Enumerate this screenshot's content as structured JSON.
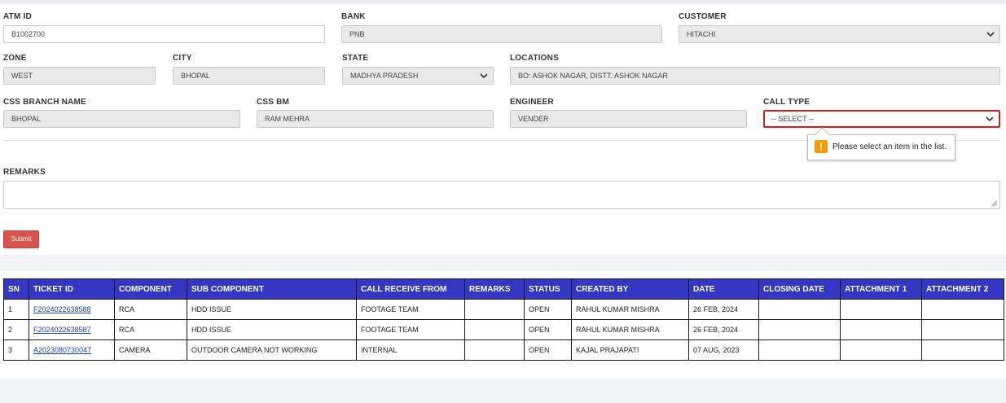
{
  "form": {
    "atm_id": {
      "label": "ATM ID",
      "value": "B1002700"
    },
    "bank": {
      "label": "BANK",
      "value": "PNB"
    },
    "customer": {
      "label": "CUSTOMER",
      "value": "HITACHI"
    },
    "zone": {
      "label": "ZONE",
      "value": "WEST"
    },
    "city": {
      "label": "CITY",
      "value": "BHOPAL"
    },
    "state": {
      "label": "STATE",
      "value": "MADHYA PRADESH"
    },
    "locations": {
      "label": "LOCATIONS",
      "value": "BO: ASHOK NAGAR, DISTT. ASHOK NAGAR"
    },
    "css_branch_name": {
      "label": "CSS BRANCH NAME",
      "value": "BHOPAL"
    },
    "css_bm": {
      "label": "CSS BM",
      "value": "RAM MEHRA"
    },
    "engineer": {
      "label": "ENGINEER",
      "value": "VENDER"
    },
    "call_type": {
      "label": "CALL TYPE",
      "value": "-- SELECT --"
    },
    "remarks": {
      "label": "REMARKS",
      "value": ""
    },
    "submit_label": "Submit"
  },
  "validation": {
    "message": "Please select an item in the list.",
    "icon": "warning-icon",
    "color": "#f39c12"
  },
  "colors": {
    "table_header": "#3437c4",
    "submit": "#d9534f",
    "invalid_border": "#d81b1b",
    "link": "#1a3ed6"
  },
  "table": {
    "headers": [
      "SN",
      "TICKET ID",
      "COMPONENT",
      "SUB COMPONENT",
      "CALL RECEIVE FROM",
      "REMARKS",
      "STATUS",
      "CREATED BY",
      "DATE",
      "CLOSING DATE",
      "ATTACHMENT 1",
      "ATTACHMENT 2"
    ],
    "rows": [
      {
        "sn": "1",
        "ticket_id": "F2024022638588",
        "component": "RCA",
        "sub_component": "HDD ISSUE",
        "call_receive_from": "FOOTAGE TEAM",
        "remarks": "",
        "status": "OPEN",
        "created_by": "RAHUL KUMAR MISHRA",
        "date": "26 FEB, 2024",
        "closing_date": "",
        "attachment_1": "",
        "attachment_2": ""
      },
      {
        "sn": "2",
        "ticket_id": "F2024022638587",
        "component": "RCA",
        "sub_component": "HDD ISSUE",
        "call_receive_from": "FOOTAGE TEAM",
        "remarks": "",
        "status": "OPEN",
        "created_by": "RAHUL KUMAR MISHRA",
        "date": "26 FEB, 2024",
        "closing_date": "",
        "attachment_1": "",
        "attachment_2": ""
      },
      {
        "sn": "3",
        "ticket_id": "A2023080730047",
        "component": "CAMERA",
        "sub_component": "OUTDOOR CAMERA NOT WORKING",
        "call_receive_from": "INTERNAL",
        "remarks": "",
        "status": "OPEN",
        "created_by": "KAJAL PRAJAPATI",
        "date": "07 AUG, 2023",
        "closing_date": "",
        "attachment_1": "",
        "attachment_2": ""
      }
    ]
  }
}
